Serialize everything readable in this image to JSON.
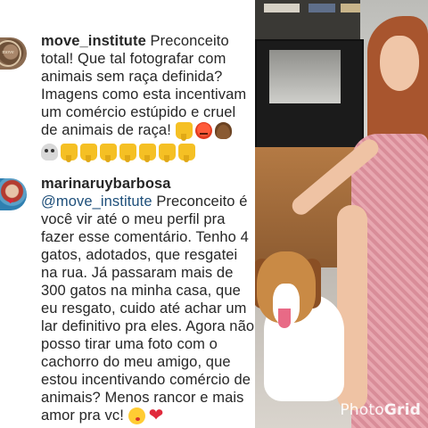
{
  "comments": [
    {
      "username": "move_institute",
      "lines": [
        " Preconceito",
        "total! Que tal fotografar com",
        "animais sem raça definida?",
        "Imagens como esta incentivam",
        "um comércio estúpido e cruel",
        "de animais de raça! "
      ],
      "emoji_line1": [
        "thumbs-down-icon",
        "angry-face-icon",
        "pile-of-poo-icon"
      ],
      "emoji_line2": [
        "skull-icon",
        "thumbs-down-icon",
        "thumbs-down-icon",
        "thumbs-down-icon",
        "thumbs-down-icon",
        "thumbs-down-icon",
        "thumbs-down-icon",
        "thumbs-down-icon"
      ]
    },
    {
      "username": "marinaruybarbosa",
      "mention": "@move_institute",
      "lines": [
        " Preconceito é",
        "você vir até o meu perfil pra",
        "fazer esse comentário. Tenho 4",
        "gatos, adotados, que resgatei",
        "na rua. Já passaram mais de",
        "300 gatos na minha casa, que",
        "eu resgato, cuido até achar um",
        "lar definitivo pra eles. Agora não",
        "posso tirar uma foto com o",
        "cachorro do meu amigo, que",
        "estou incentivando comércio de",
        "animais? Menos rancor e mais",
        "amor pra vc! "
      ],
      "emoji_end": [
        "face-blowing-kiss-icon",
        "red-heart-icon"
      ],
      "heart_glyph": "❤"
    }
  ],
  "photo": {
    "watermark_prefix": "Photo",
    "watermark_suffix": "Grid",
    "colors": {
      "hair": "#a8552e",
      "dress": "#e8a7b0",
      "sofa": "#b47a44",
      "dog": "#c98a45"
    }
  },
  "avatar_text": "move"
}
